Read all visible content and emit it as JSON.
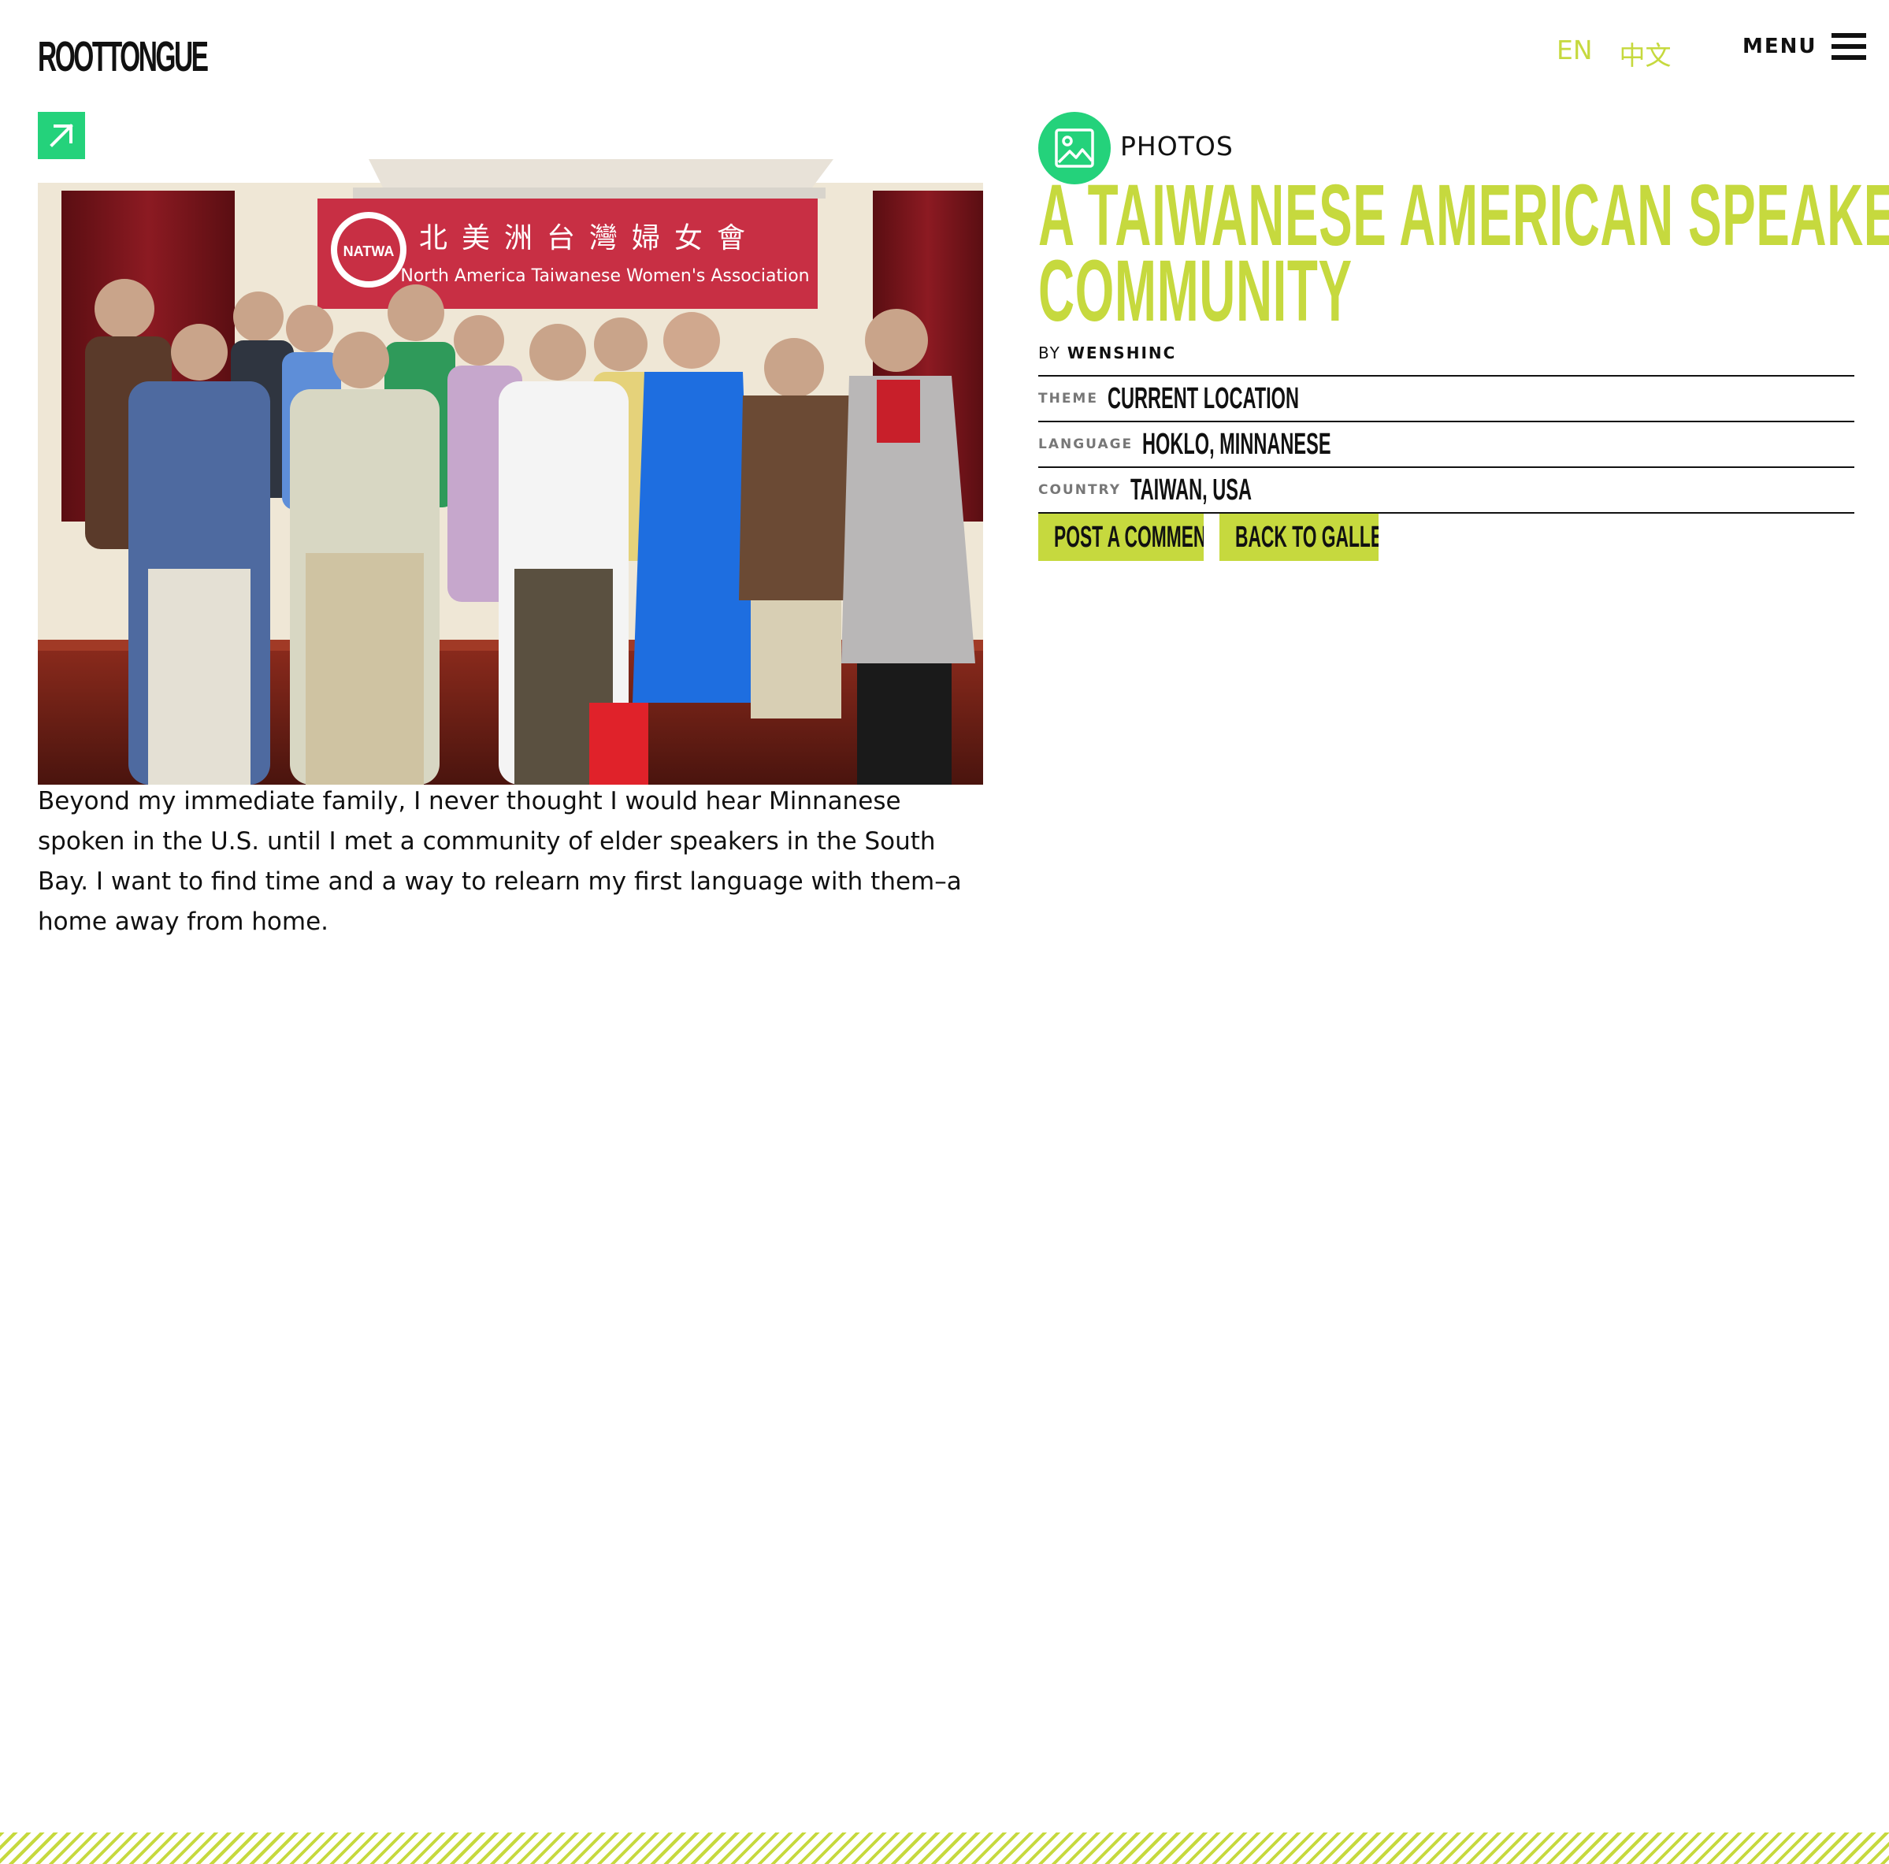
{
  "header": {
    "logo_text": "ROOTTONGUE",
    "languages": [
      "EN",
      "中文"
    ],
    "menu_label": "MENU"
  },
  "post": {
    "media_type": "PHOTOS",
    "title_lines": [
      "A TAIWANESE AMERICAN SPEAKER",
      "COMMUNITY"
    ],
    "by_label": "BY",
    "author": "WENSHINC",
    "caption": "Beyond my immediate family, I never thought I would hear Minnanese spoken in the U.S. until I met a community of elder speakers in the South Bay. I want to find time and a way to relearn my first language with them–a home away from home.",
    "meta": [
      {
        "key": "THEME",
        "value": "CURRENT LOCATION"
      },
      {
        "key": "LANGUAGE",
        "value": "HOKLO, MINNANESE"
      },
      {
        "key": "COUNTRY",
        "value": "TAIWAN, USA"
      }
    ],
    "actions": {
      "comment": "POST A COMMENT",
      "gallery": "BACK TO GALLERY"
    }
  },
  "photo": {
    "banner_chinese": "北美洲台灣婦女會",
    "banner_english": "North America Taiwanese Women's Association",
    "banner_logo": "NATWA"
  },
  "colors": {
    "accent_lime": "#c6d93e",
    "accent_green": "#24d27b",
    "text": "#111111"
  },
  "icons": {
    "expand": "arrow-up-right-icon",
    "media": "image-icon",
    "menu": "hamburger-icon"
  }
}
